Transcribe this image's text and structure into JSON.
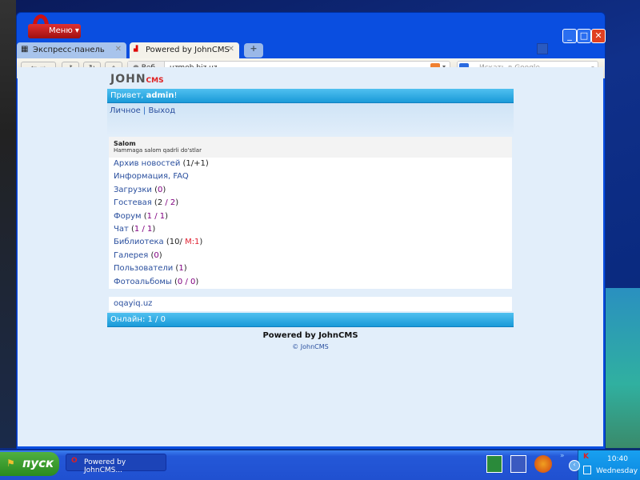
{
  "browser": {
    "menu_label": "Меню",
    "tabs": [
      {
        "label": "Экспресс-панель",
        "active": false
      },
      {
        "label": "Powered by JohnCMS",
        "active": true
      }
    ],
    "address_prefix": "Веб",
    "address": "uzmob.biz.uz",
    "search_placeholder": "Искать в Google"
  },
  "page": {
    "logo": {
      "john": "JOHN",
      "cms": "CMS"
    },
    "greeting_prefix": "Привет, ",
    "greeting_user": "admin",
    "greeting_suffix": "!",
    "user_links": [
      {
        "label": "Личное"
      },
      {
        "sep": " | "
      },
      {
        "label": "Выход"
      }
    ],
    "news": {
      "title": "Salom",
      "text": "Hammaga salom qadrli do'stlar"
    },
    "menu": [
      {
        "label": "Архив новостей",
        "open": " (",
        "counts": [
          {
            "v": "1",
            "c": "n"
          },
          {
            "v": "/+1",
            "c": "n"
          }
        ],
        "close": ")"
      },
      {
        "label": "Информация, FAQ"
      },
      {
        "label": "Загрузки",
        "open": " (",
        "counts": [
          {
            "v": "0",
            "c": "p"
          }
        ],
        "close": ")"
      },
      {
        "label": "Гостевая",
        "open": " (",
        "counts": [
          {
            "v": "2",
            "c": "n"
          },
          {
            "v": " / 2",
            "c": "p"
          }
        ],
        "close": ")"
      },
      {
        "label": "Форум",
        "open": " (",
        "counts": [
          {
            "v": "1",
            "c": "p"
          },
          {
            "v": " / 1",
            "c": "p"
          }
        ],
        "close": ")"
      },
      {
        "label": "Чат",
        "open": " (",
        "counts": [
          {
            "v": "1",
            "c": "p"
          },
          {
            "v": " / 1",
            "c": "p"
          }
        ],
        "close": ")"
      },
      {
        "label": "Библиотека",
        "open": " (",
        "counts": [
          {
            "v": "10/ ",
            "c": "n"
          },
          {
            "v": "M:1",
            "c": "r"
          }
        ],
        "close": ")"
      },
      {
        "label": "Галерея",
        "open": " (",
        "counts": [
          {
            "v": "0",
            "c": "p"
          }
        ],
        "close": ")"
      },
      {
        "label": "Пользователи",
        "open": " (",
        "counts": [
          {
            "v": "1",
            "c": "p"
          }
        ],
        "close": ")"
      },
      {
        "label": "Фотоальбомы",
        "open": " (",
        "counts": [
          {
            "v": "0",
            "c": "p"
          },
          {
            "v": " / 0",
            "c": "p"
          }
        ],
        "close": ")"
      }
    ],
    "site_link": "oqayiq.uz",
    "online": "Онлайн: 1 / 0",
    "powered": "Powered by JohnCMS",
    "copyright": "© JohnCMS"
  },
  "taskbar": {
    "start": "пуск",
    "task": "Powered by JohnCMS...",
    "time": "10:40",
    "day": "Wednesday"
  }
}
